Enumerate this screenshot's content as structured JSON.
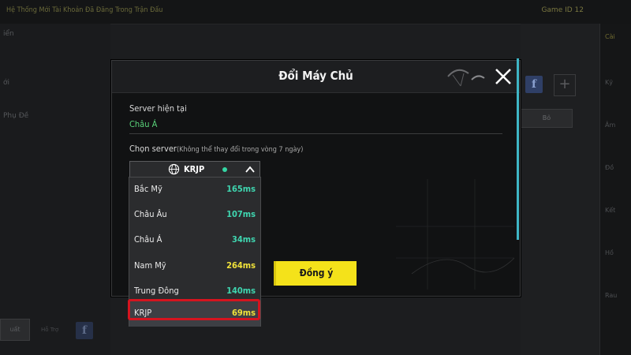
{
  "background": {
    "topbar_left": "Hệ Thống Mới  Tài Khoản Đã Đăng Trong Trận Đấu",
    "topbar_right": "Game ID 12",
    "left_items": [
      "iển",
      "ới",
      "Phụ Đề"
    ],
    "right_tabs": [
      "Cài",
      "Kỹ",
      "Âm",
      "Đồ",
      "Kết",
      "Hồ",
      "Rau"
    ],
    "facebook_glyph": "f",
    "plus_glyph": "+",
    "btn_label": "Bỏ",
    "bottom_btn": "uất",
    "bottom_text": "Hỗ Trợ"
  },
  "modal": {
    "title": "Đổi Máy Chủ",
    "current_label": "Server hiện tại",
    "current_value": "Châu Á",
    "choose_label": "Chọn server",
    "choose_note": "(Không thể thay đổi trong vòng 7 ngày)",
    "selected_server": "KRJP",
    "servers": [
      {
        "name": "Bắc Mỹ",
        "ping": "165ms",
        "color": "#3fd6b0"
      },
      {
        "name": "Châu Âu",
        "ping": "107ms",
        "color": "#3fd6b0"
      },
      {
        "name": "Châu Á",
        "ping": "34ms",
        "color": "#3fd6b0"
      },
      {
        "name": "Nam Mỹ",
        "ping": "264ms",
        "color": "#f0e23a"
      },
      {
        "name": "Trung Đông",
        "ping": "140ms",
        "color": "#3fd6b0"
      },
      {
        "name": "KRJP",
        "ping": "69ms",
        "color": "#f0e23a"
      }
    ],
    "confirm_label": "Đồng ý"
  },
  "colors": {
    "accent_yellow": "#f4e21a",
    "ping_green": "#3fd6b0",
    "ping_yellow": "#f0e23a",
    "current_green": "#5ad37a",
    "highlight_red": "#d4141f"
  }
}
